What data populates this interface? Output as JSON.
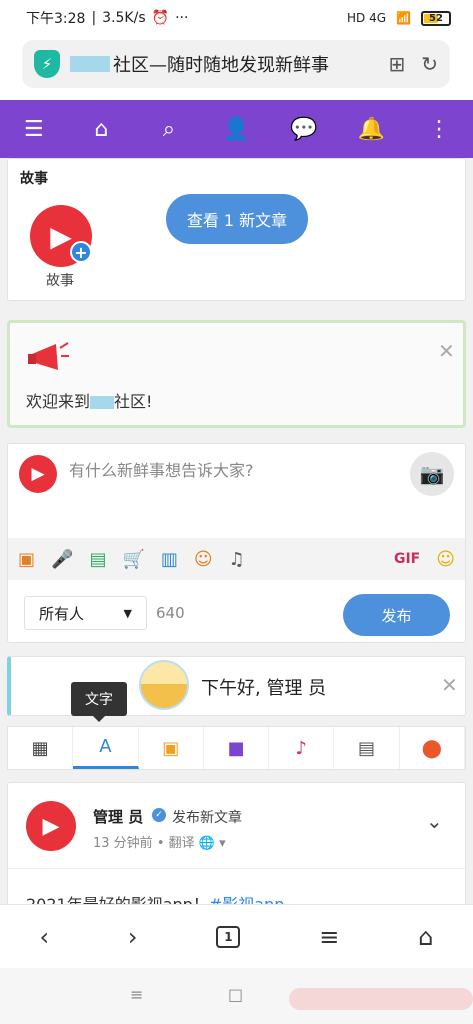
{
  "status": {
    "time": "下午3:28",
    "speed": "3.5K/s",
    "alarm_icon": "alarm-icon",
    "more": "···",
    "network": "HD 4G",
    "battery": "52",
    "battery_level_percent": 52
  },
  "browser": {
    "title_suffix": "社区—随时随地发现新鲜事",
    "bookmark_icon": "bookmark-add-icon",
    "reload_icon": "reload-icon"
  },
  "nav": {
    "items": [
      "menu-icon",
      "home-icon",
      "search-icon",
      "add-user-icon",
      "messages-icon",
      "bell-icon",
      "more-vert-icon"
    ],
    "color": "#7d44cf"
  },
  "stories": {
    "title": "故事",
    "label": "故事",
    "button": "查看 1 新文章"
  },
  "welcome": {
    "prefix": "欢迎来到",
    "suffix": "社区!"
  },
  "composer": {
    "placeholder": "有什么新鲜事想告诉大家?",
    "attach": [
      "video-icon",
      "mic-icon",
      "file-icon",
      "cart-icon",
      "poll-icon",
      "feeling-icon",
      "music-icon"
    ],
    "gif": "GIF",
    "audience": "所有人",
    "count": "640",
    "publish": "发布"
  },
  "greeting": {
    "text": "下午好, 管理 员"
  },
  "tooltip": "文字",
  "filter_tabs": [
    "grid-icon",
    "text-icon",
    "image-icon",
    "video-icon",
    "music-icon",
    "file-icon",
    "location-icon"
  ],
  "post": {
    "author": "管理 员",
    "action": "发布新文章",
    "time": "13 分钟前",
    "translate": "翻译",
    "body_text": "2021年最好的影视app！",
    "body_tag": "#影视app"
  },
  "bottom_nav": {
    "tabs_count": "1"
  },
  "colors": {
    "accent": "#4d90dc",
    "brand_red": "#e8323b",
    "nav_purple": "#7d44cf"
  }
}
